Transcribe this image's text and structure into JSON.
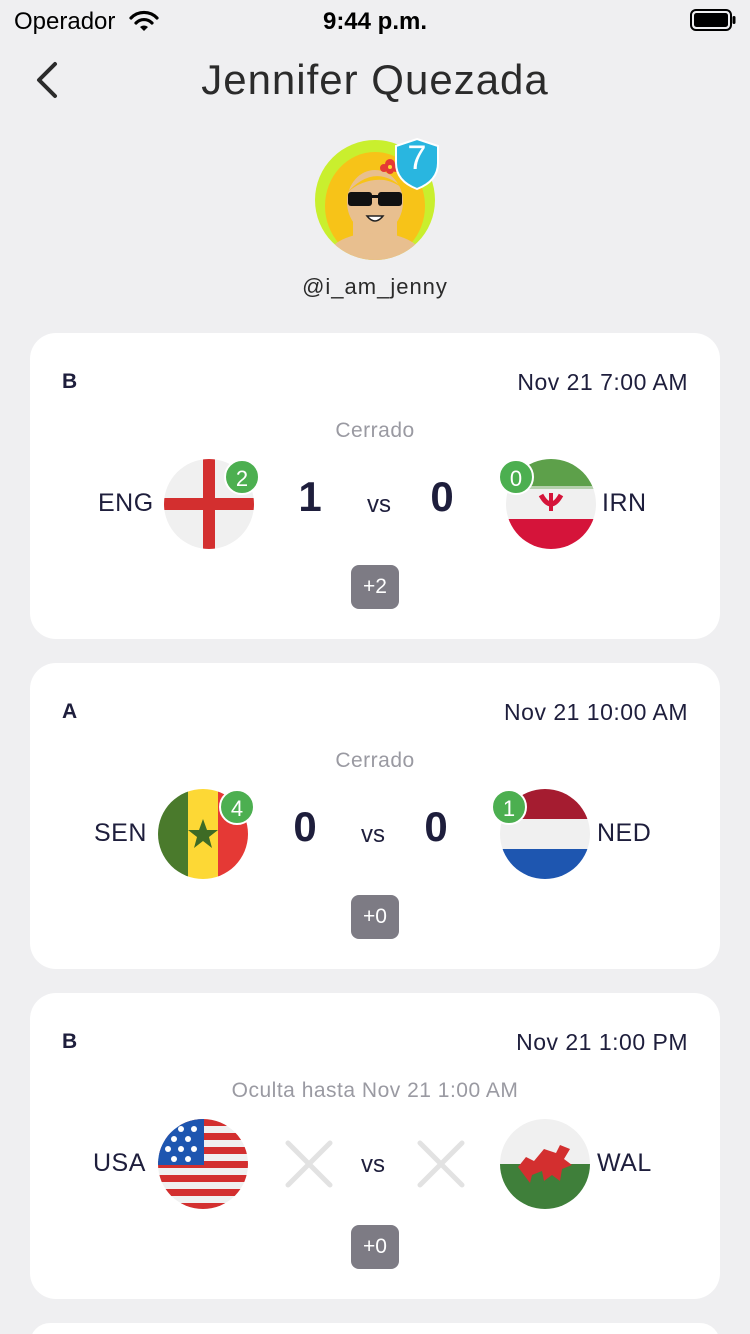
{
  "status_bar": {
    "carrier": "Operador",
    "time": "9:44 p.m."
  },
  "header": {
    "title": "Jennifer Quezada"
  },
  "profile": {
    "level": "7",
    "username": "@i_am_jenny"
  },
  "matches": [
    {
      "group": "B",
      "datetime": "Nov 21 7:00 AM",
      "status": "Cerrado",
      "home": {
        "code": "ENG",
        "flag": "england-flag",
        "picks": "2",
        "score": "1"
      },
      "away": {
        "code": "IRN",
        "flag": "iran-flag",
        "picks": "0",
        "score": "0"
      },
      "vs": "vs",
      "extra_picks": "+2"
    },
    {
      "group": "A",
      "datetime": "Nov 21 10:00 AM",
      "status": "Cerrado",
      "home": {
        "code": "SEN",
        "flag": "senegal-flag",
        "picks": "4",
        "score": "0"
      },
      "away": {
        "code": "NED",
        "flag": "netherlands-flag",
        "picks": "1",
        "score": "0"
      },
      "vs": "vs",
      "extra_picks": "+0"
    },
    {
      "group": "B",
      "datetime": "Nov 21 1:00 PM",
      "status": "Oculta hasta Nov 21 1:00 AM",
      "home": {
        "code": "USA",
        "flag": "usa-flag"
      },
      "away": {
        "code": "WAL",
        "flag": "wales-flag"
      },
      "vs": "vs",
      "extra_picks": "+0"
    }
  ],
  "colors": {
    "pick_badge": "#4caf50",
    "level_badge": "#29b6e0",
    "picks_button": "#7d7b84"
  }
}
